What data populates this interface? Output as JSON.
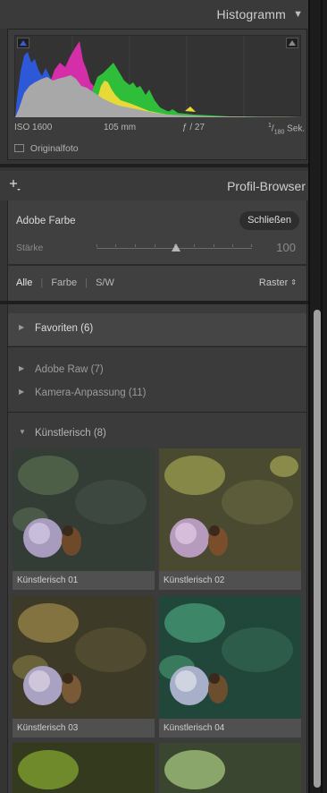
{
  "histogram": {
    "title": "Histogramm",
    "iso": "ISO 1600",
    "focal": "105 mm",
    "aperture": "ƒ / 27",
    "shutter_num": "1",
    "shutter_den": "180",
    "shutter_unit": "Sek.",
    "original_label": "Originalfoto"
  },
  "profile_browser": {
    "title": "Profil-Browser",
    "profile_name": "Adobe Farbe",
    "close_label": "Schließen",
    "strength_label": "Stärke",
    "strength_value": "100",
    "filters": [
      "Alle",
      "Farbe",
      "S/W"
    ],
    "active_filter": "Alle",
    "view_mode": "Raster"
  },
  "categories": [
    {
      "label": "Favoriten (6)"
    },
    {
      "label": "Adobe Raw (7)"
    },
    {
      "label": "Kamera-Anpassung (11)"
    },
    {
      "label": "Künstlerisch (8)"
    }
  ],
  "thumbnails": [
    {
      "label": "Künstlerisch 01",
      "tint": "#3c4b3a"
    },
    {
      "label": "Künstlerisch 02",
      "tint": "#7a7a3c"
    },
    {
      "label": "Künstlerisch 03",
      "tint": "#6f6a3a"
    },
    {
      "label": "Künstlerisch 04",
      "tint": "#2f7a5b"
    }
  ],
  "colors": {
    "accent_blue": "#3a5bd6",
    "panel_bg": "#343434"
  }
}
